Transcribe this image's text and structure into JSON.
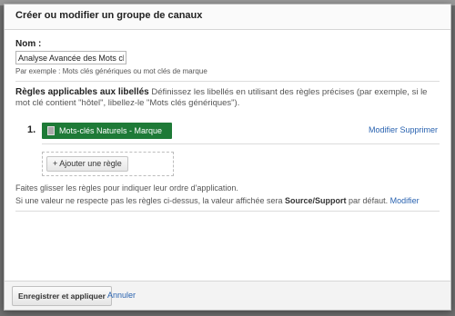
{
  "dialog": {
    "title": "Créer ou modifier un groupe de canaux"
  },
  "name_field": {
    "label": "Nom :",
    "value": "Analyse Avancée des Mots clés",
    "hint": "Par exemple : Mots clés génériques ou mot clés de marque"
  },
  "rules": {
    "heading": "Règles applicables aux libellés",
    "description": "Définissez les libellés en utilisant des règles précises (par exemple, si le mot clé contient \"hôtel\", libellez-le \"Mots clés génériques\").",
    "items": [
      {
        "number": "1.",
        "label": "Mots-clés Naturels - Marque",
        "color": "#1e7a37",
        "edit_label": "Modifier",
        "delete_label": "Supprimer"
      }
    ],
    "add_button": "+ Ajouter une règle"
  },
  "info": {
    "line1": "Faites glisser les règles pour indiquer leur ordre d'application.",
    "line2_prefix": "Si une valeur ne respecte pas les règles ci-dessus, la valeur affichée sera",
    "line2_value": "Source/Support",
    "line2_suffix": "par défaut.",
    "modify_link": "Modifier"
  },
  "footer": {
    "save_label": "Enregistrer et appliquer",
    "cancel_label": "Annuler"
  }
}
